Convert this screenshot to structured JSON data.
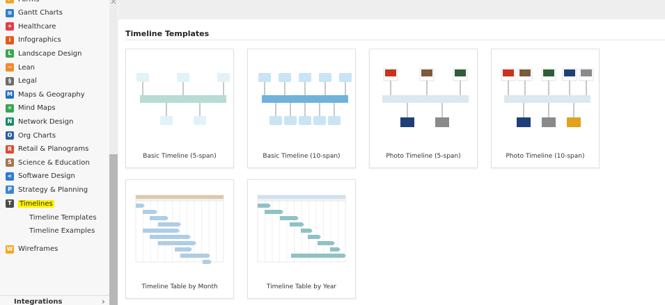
{
  "sidebar": {
    "items": [
      {
        "label": "Forms",
        "icon": "forms-icon",
        "color": "#f4a623",
        "glyph": "F"
      },
      {
        "label": "Gantt Charts",
        "icon": "gantt-charts-icon",
        "color": "#2f7fd1",
        "glyph": "≡"
      },
      {
        "label": "Healthcare",
        "icon": "healthcare-icon",
        "color": "#e23c4b",
        "glyph": "+"
      },
      {
        "label": "Infographics",
        "icon": "infographics-icon",
        "color": "#e25a1c",
        "glyph": "i"
      },
      {
        "label": "Landscape Design",
        "icon": "landscape-design-icon",
        "color": "#3aa84d",
        "glyph": "L"
      },
      {
        "label": "Lean",
        "icon": "lean-icon",
        "color": "#f28b2a",
        "glyph": "~"
      },
      {
        "label": "Legal",
        "icon": "legal-icon",
        "color": "#6d6d6d",
        "glyph": "§"
      },
      {
        "label": "Maps & Geography",
        "icon": "maps-geography-icon",
        "color": "#1e6fc9",
        "glyph": "M"
      },
      {
        "label": "Mind Maps",
        "icon": "mind-maps-icon",
        "color": "#38a356",
        "glyph": "✳"
      },
      {
        "label": "Network Design",
        "icon": "network-design-icon",
        "color": "#1c8b6b",
        "glyph": "N"
      },
      {
        "label": "Org Charts",
        "icon": "org-charts-icon",
        "color": "#2c5ea8",
        "glyph": "O"
      },
      {
        "label": "Retail & Planograms",
        "icon": "retail-planograms-icon",
        "color": "#e4472e",
        "glyph": "R"
      },
      {
        "label": "Science & Education",
        "icon": "science-education-icon",
        "color": "#a0784c",
        "glyph": "S"
      },
      {
        "label": "Software Design",
        "icon": "software-design-icon",
        "color": "#2b7bd4",
        "glyph": "<"
      },
      {
        "label": "Strategy & Planning",
        "icon": "strategy-planning-icon",
        "color": "#3a86d6",
        "glyph": "P"
      },
      {
        "label": "Timelines",
        "icon": "timelines-icon",
        "color": "#4a4a4a",
        "glyph": "T"
      }
    ],
    "subitems": [
      "Timeline Templates",
      "Timeline Examples"
    ],
    "wireframes": {
      "label": "Wireframes",
      "icon": "wireframes-icon",
      "color": "#f5a623",
      "glyph": "W"
    },
    "integrations_label": "Integrations",
    "integrations_chevron": "›",
    "close_glyph": "×"
  },
  "main": {
    "section_title": "Timeline Templates",
    "cards": [
      {
        "label": "Basic Timeline (5-span)",
        "kind": "basic5"
      },
      {
        "label": "Basic Timeline (10-span)",
        "kind": "basic10"
      },
      {
        "label": "Photo Timeline (5-span)",
        "kind": "photo5"
      },
      {
        "label": "Photo Timeline (10-span)",
        "kind": "photo10"
      },
      {
        "label": "Timeline Table by Month",
        "kind": "tablemonth"
      },
      {
        "label": "Timeline Table by Year",
        "kind": "tableyear"
      }
    ]
  },
  "colors": {
    "highlight": "#fff200",
    "basic_bar": "#b6dcd6",
    "basic_box": "#e2f2f9",
    "basic10_bar": "#6fb3dc",
    "basic10_box": "#c9e4f5",
    "photo_bar": "#dbe8f1",
    "month_bar": "#aecde6",
    "year_bar": "#8fc2c6"
  }
}
